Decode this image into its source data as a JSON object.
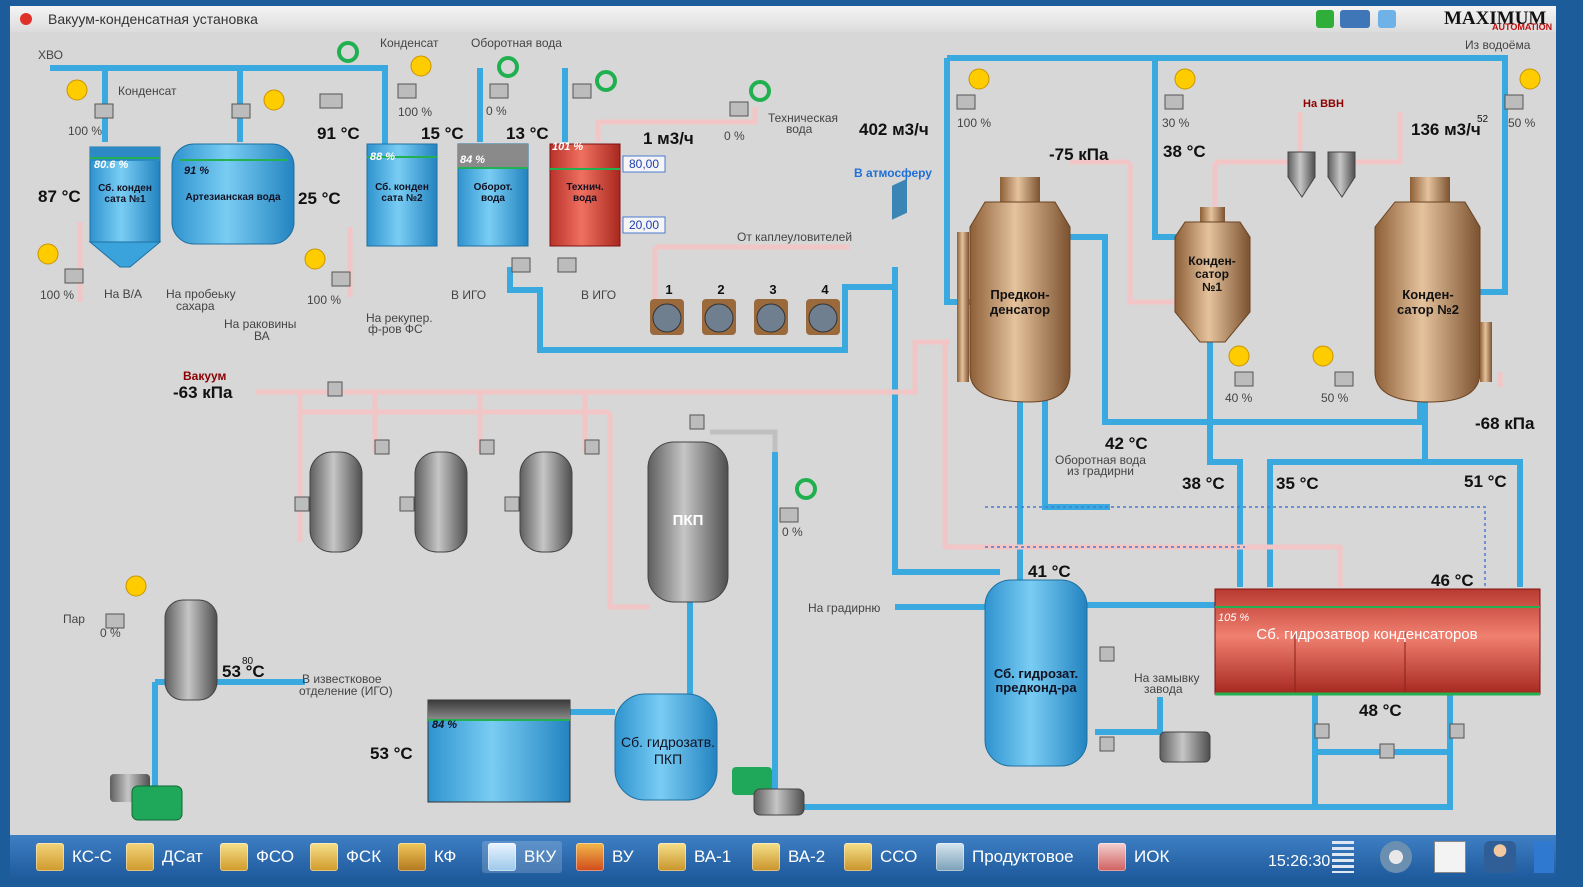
{
  "window": {
    "title": "Вакуум-конденсатная установка",
    "logo": "MAXIMUM",
    "logo_sub": "AUTOMATION"
  },
  "colors": {
    "pipe_water": "#39a9e0",
    "pipe_vacuum": "#f2c6c6",
    "tank_blue": "#4fb4e6",
    "tank_red": "#d9463a",
    "copper": "#b9895d",
    "panel_bg": "#d7d7d7",
    "title_red": "#8b0000",
    "link_blue": "#1f6fd6",
    "hand": "#ffcc00",
    "refresh": "#20b050"
  },
  "labels": {
    "hvo": "ХВО",
    "kondensat_top": "Конденсат",
    "oborotnaya_top": "Оборотная вода",
    "kondensat_left": "Конденсат",
    "tech_water_1": "Техническая",
    "tech_water_2": "вода",
    "iz_vodoema": "Из водоёма",
    "na_vvn": "На ВВН",
    "v_atmosferu": "В атмосферу",
    "ot_kapleulov": "От каплеуловителей",
    "na_va": "На В/А",
    "na_probu_1": "На пробеьку",
    "na_probu_2": "сахара",
    "na_rakoviny_1": "На раковины",
    "na_rakoviny_2": "ВА",
    "na_rekuper_1": "На рекупер.",
    "na_rekuper_2": "ф-ров ФС",
    "v_igo_1": "В ИГО",
    "v_igo_2": "В ИГО",
    "vakuum": "Вакуум",
    "oborot_gradirni_1": "Оборотная вода",
    "oborot_gradirni_2": "из градирни",
    "na_gradirnyu": "На градирню",
    "par": "Пар",
    "v_izvest_1": "В известковое",
    "v_izvest_2": "отделение (ИГО)",
    "na_zamyvku_1": "На замывку",
    "na_zamyvku_2": "завода"
  },
  "tanks": {
    "sb1_name_1": "Сб. конден",
    "sb1_name_2": "сата №1",
    "sb1_level": "80.6 %",
    "art_name": "Артезианская вода",
    "art_level": "91 %",
    "sb2_name_1": "Сб. конден",
    "sb2_name_2": "сата №2",
    "sb2_level": "88 %",
    "obor_name_1": "Оборот.",
    "obor_name_2": "вода",
    "obor_level": "84 %",
    "tech_name_1": "Технич.",
    "tech_name_2": "вода",
    "tech_level": "101 %",
    "pkp_name": "ПКП",
    "gidro_pkp_1": "Сб. гидрозатв.",
    "gidro_pkp_2": "ПКП",
    "bottom_level": "84 %",
    "gidro_pred_1": "Сб. гидрозат.",
    "gidro_pred_2": "предконд-ра",
    "gidro_kond_name": "Сб. гидрозатвор конденсаторов",
    "gidro_kond_level": "105 %",
    "predkond_1": "Предкон-",
    "predkond_2": "денсатор",
    "kond1_1": "Конден-",
    "kond1_2": "сатор",
    "kond1_3": "№1",
    "kond2_1": "Конден-",
    "kond2_2": "сатор №2"
  },
  "readings": {
    "t87": "87 °C",
    "t25": "25 °C",
    "t91": "91 °C",
    "t15": "15 °C",
    "t13": "13 °C",
    "flow1": "1 м3/ч",
    "flow402": "402 м3/ч",
    "p75": "-75 кПа",
    "t38top": "38 °C",
    "flow136": "136 м3/ч",
    "sup52": "52",
    "vac63": "-63 кПа",
    "p68": "-68 кПа",
    "t42": "42 °C",
    "t38": "38 °C",
    "t35": "35 °C",
    "t51": "51 °C",
    "t41": "41 °C",
    "t46": "46 °C",
    "t48": "48 °C",
    "t53a": "53 °C",
    "sup80": "80",
    "t53b": "53 °C",
    "sp_high": "80,00",
    "sp_low": "20,00"
  },
  "valves": {
    "v1": "100 %",
    "v2": "100 %",
    "v3": "0 %",
    "v4": "0 %",
    "v5": "100 %",
    "v6": "100 %",
    "v7": "100 %",
    "v8": "30 %",
    "v9": "50 %",
    "v10": "40 %",
    "v11": "50 %",
    "v12": "0 %",
    "v13": "0 %"
  },
  "pumps": [
    "1",
    "2",
    "3",
    "4"
  ],
  "taskbar": {
    "items": [
      "КС-С",
      "ДСат",
      "ФСО",
      "ФСК",
      "КФ",
      "ВКУ",
      "ВУ",
      "ВА-1",
      "ВА-2",
      "ССО",
      "Продуктовое",
      "ИОК"
    ],
    "active_index": 5,
    "clock": "15:26:30"
  },
  "icons": [
    "hand-icon",
    "refresh-icon",
    "valve-icon",
    "pump-icon",
    "settings-icon",
    "chart-icon",
    "user-icon",
    "network-icon"
  ]
}
